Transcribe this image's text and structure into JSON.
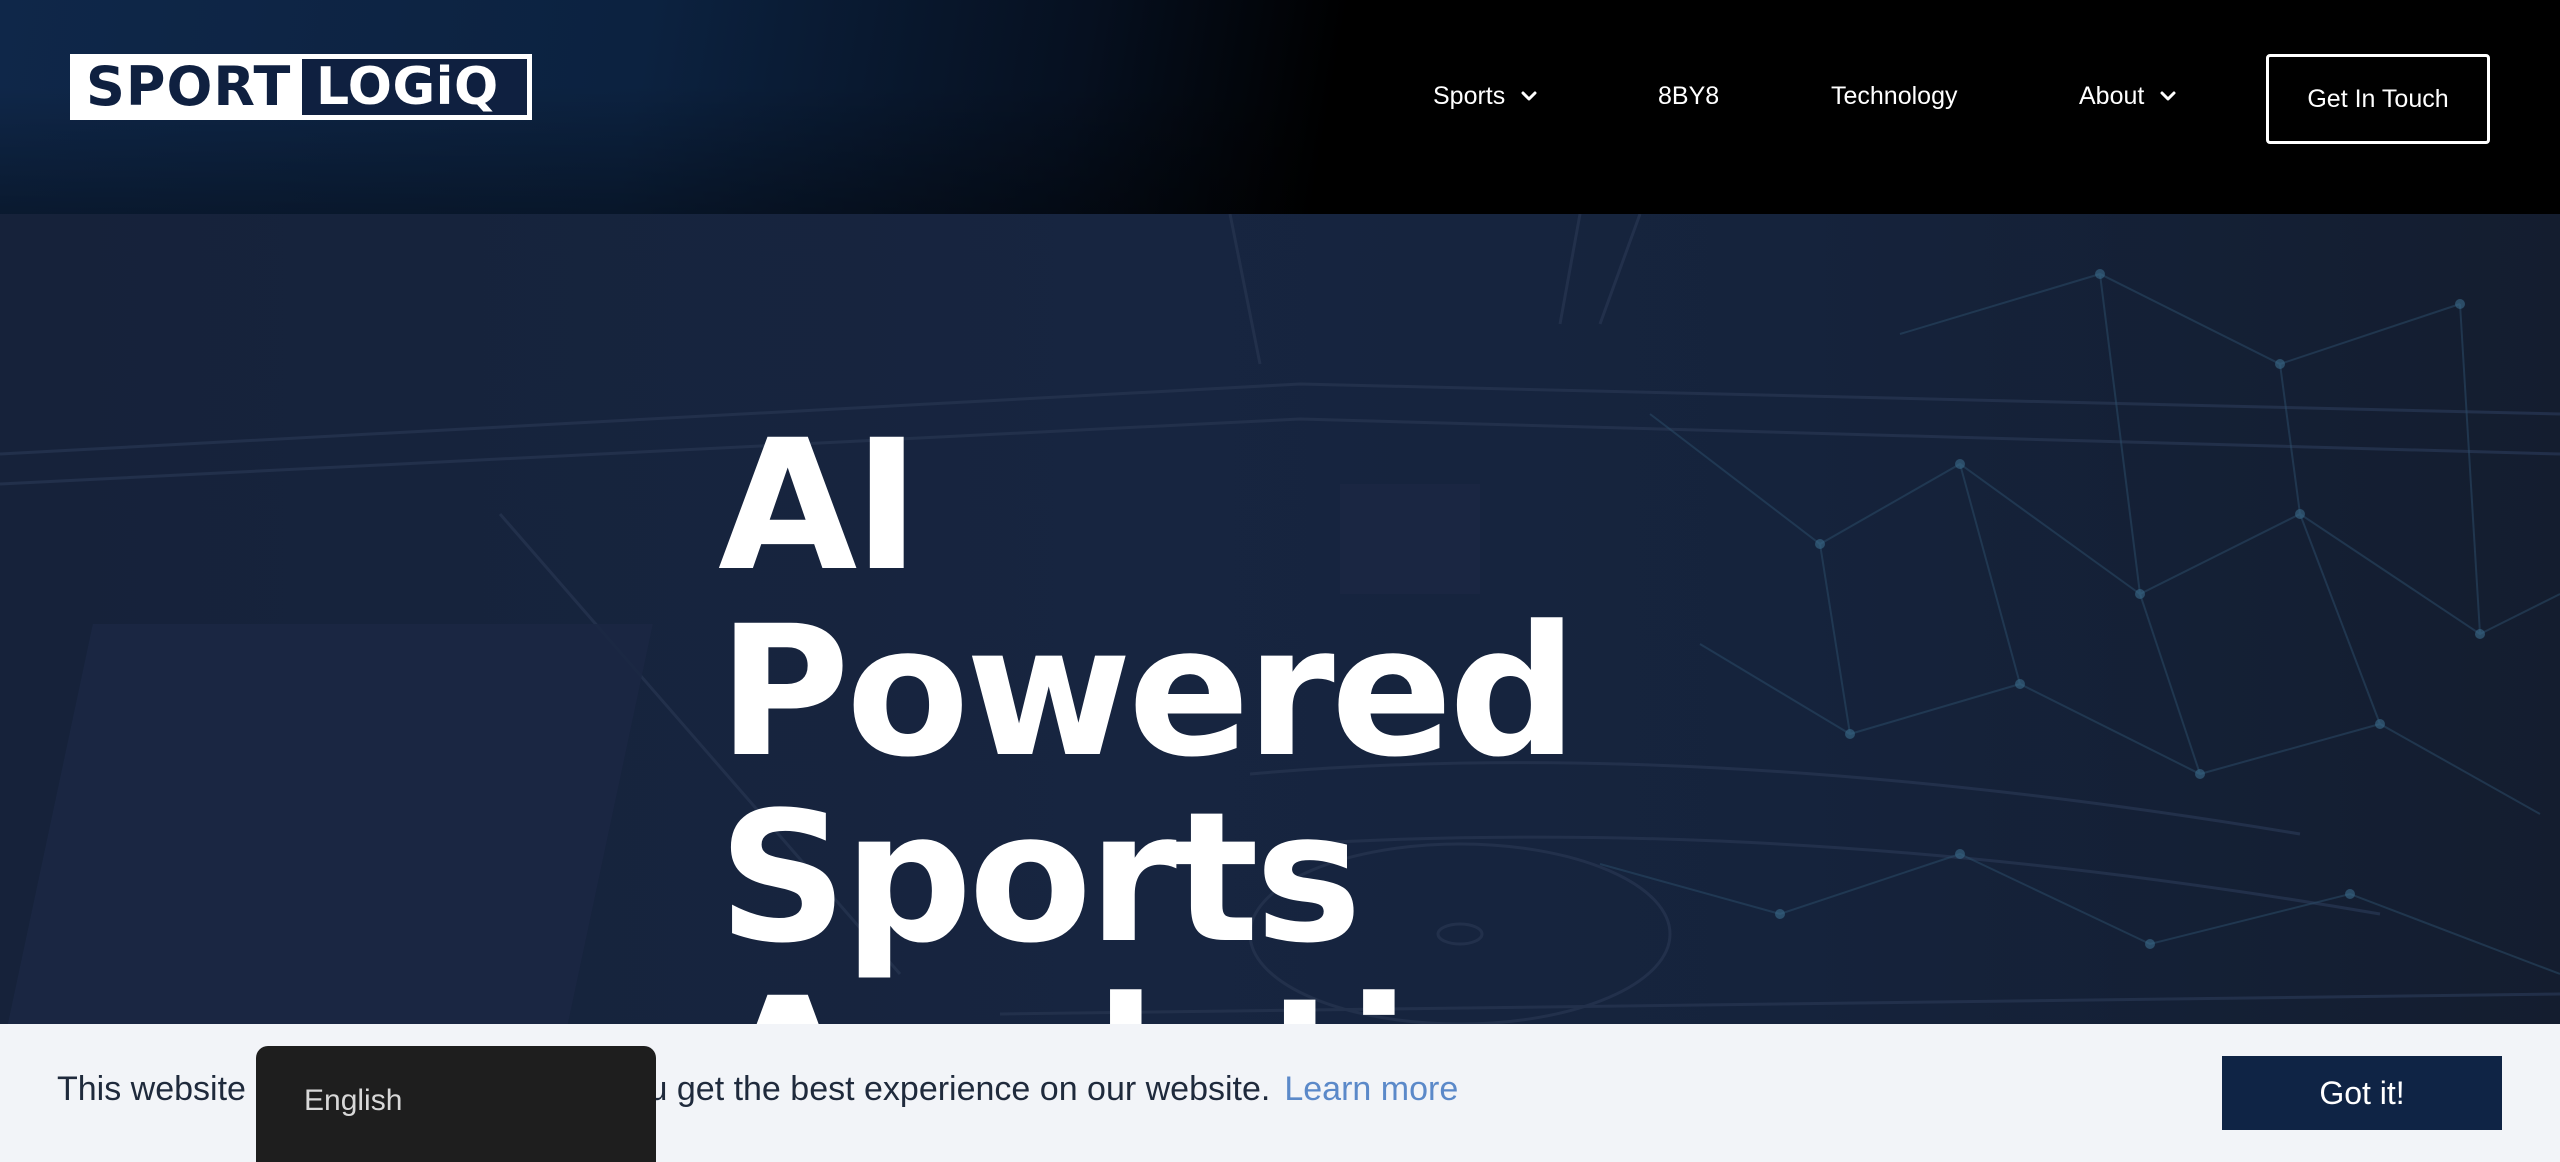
{
  "brand": {
    "part1": "SPORT",
    "part2": "LOGiQ"
  },
  "nav": {
    "items": [
      {
        "label": "Sports",
        "has_dropdown": true
      },
      {
        "label": "8BY8",
        "has_dropdown": false
      },
      {
        "label": "Technology",
        "has_dropdown": false
      },
      {
        "label": "About",
        "has_dropdown": true
      }
    ],
    "cta_label": "Get In Touch"
  },
  "hero": {
    "lines": [
      "AI",
      "Powered",
      "Sports",
      "Analytics"
    ]
  },
  "cookie": {
    "text": "This website uses cookies to ensure you get the best experience on our website.",
    "link_label": "Learn more",
    "button_label": "Got it!"
  },
  "language": {
    "selected": "English"
  },
  "colors": {
    "navy": "#0f2445",
    "link": "#5b89c9",
    "cookie_bg": "#f2f4f8"
  },
  "icons": {
    "dropdown": "chevron-down-icon"
  }
}
